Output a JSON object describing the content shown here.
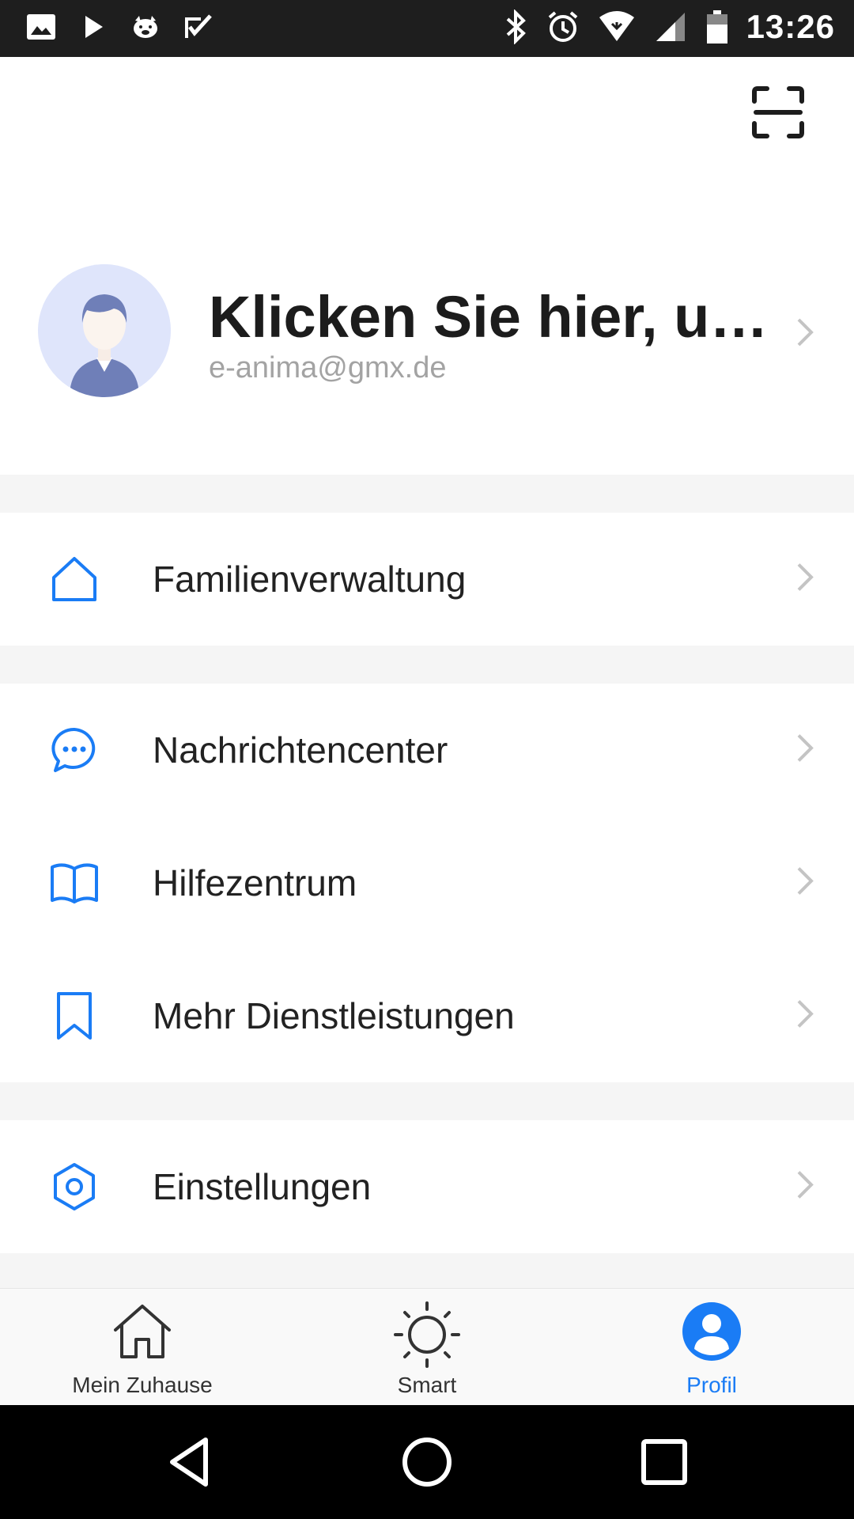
{
  "status_bar": {
    "time": "13:26",
    "left_icons": [
      "image-icon",
      "play-store-icon",
      "pig-app-icon",
      "checkmark-app-icon"
    ],
    "right_icons": [
      "bluetooth-icon",
      "alarm-icon",
      "wifi-icon",
      "signal-icon",
      "battery-icon"
    ]
  },
  "header": {
    "scan_icon": "scan-icon"
  },
  "profile": {
    "name": "Klicken Sie hier, um...",
    "email": "e-anima@gmx.de"
  },
  "menu": {
    "family": {
      "label": "Familienverwaltung",
      "icon": "home-icon"
    },
    "messages": {
      "label": "Nachrichtencenter",
      "icon": "chat-bubble-icon"
    },
    "help": {
      "label": "Hilfezentrum",
      "icon": "book-icon"
    },
    "services": {
      "label": "Mehr Dienstleistungen",
      "icon": "bookmark-icon"
    },
    "settings": {
      "label": "Einstellungen",
      "icon": "settings-icon"
    }
  },
  "bottom_nav": {
    "home": "Mein Zuhause",
    "smart": "Smart",
    "profile": "Profil",
    "active": "profile"
  },
  "colors": {
    "accent": "#1a7cf5",
    "text": "#222222",
    "muted": "#a3a3a3",
    "background": "#f5f5f5"
  }
}
